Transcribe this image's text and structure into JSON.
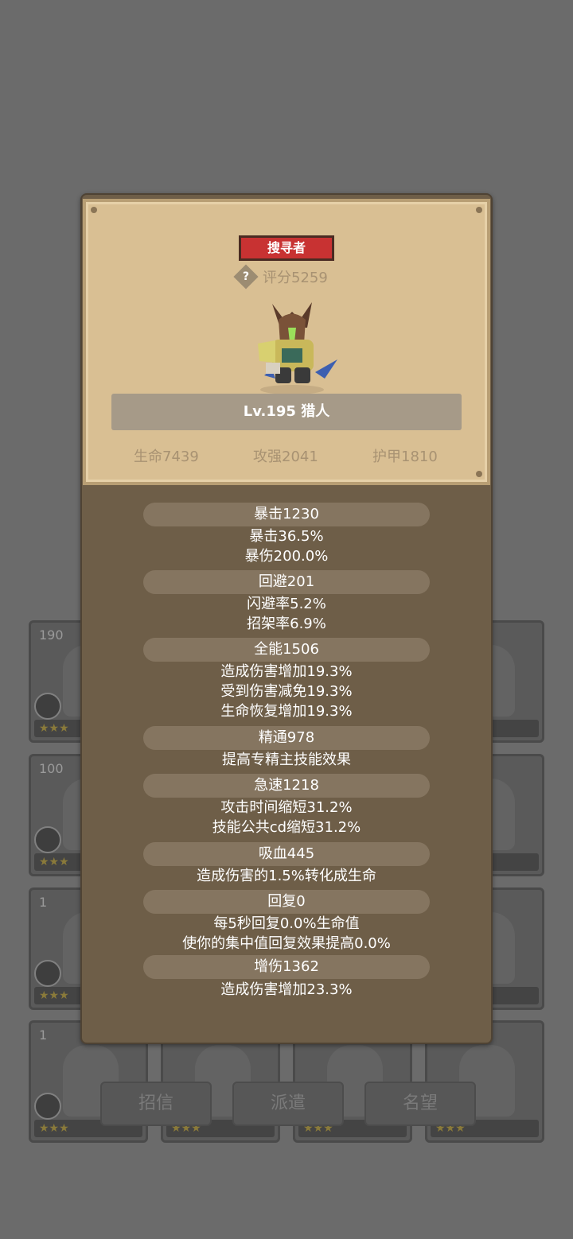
{
  "background": {
    "hero_cards": [
      {
        "level": "190",
        "stars": "★★★"
      },
      {
        "level": "",
        "stars": "★★★"
      },
      {
        "level": "100",
        "stars": "★★★"
      },
      {
        "level": "",
        "stars": "★★★"
      },
      {
        "level": "1",
        "stars": "★★★"
      },
      {
        "level": "",
        "stars": "★★★"
      },
      {
        "level": "1",
        "stars": "★★★"
      },
      {
        "level": "",
        "stars": "★★★"
      },
      {
        "level": "",
        "stars": "★★★"
      },
      {
        "level": "",
        "stars": "★★★"
      }
    ],
    "bottom_buttons": [
      "招信",
      "派遣",
      "名望"
    ]
  },
  "hero": {
    "class_badge": "搜寻者",
    "score": "评分5259",
    "name": "Lv.195 猎人",
    "hp": "生命7439",
    "attack": "攻强2041",
    "armor": "护甲1810"
  },
  "attributes": [
    {
      "header": "暴击1230",
      "details": [
        "暴击36.5%",
        "暴伤200.0%"
      ]
    },
    {
      "header": "回避201",
      "details": [
        "闪避率5.2%",
        "招架率6.9%"
      ]
    },
    {
      "header": "全能1506",
      "details": [
        "造成伤害增加19.3%",
        "受到伤害减免19.3%",
        "生命恢复增加19.3%"
      ]
    },
    {
      "header": "精通978",
      "details": [
        "提高专精主技能效果"
      ]
    },
    {
      "header": "急速1218",
      "details": [
        "攻击时间缩短31.2%",
        "技能公共cd缩短31.2%"
      ]
    },
    {
      "header": "吸血445",
      "details": [
        "造成伤害的1.5%转化成生命"
      ]
    },
    {
      "header": "回复0",
      "details": [
        "每5秒回复0.0%生命值",
        "使你的集中值回复效果提高0.0%"
      ]
    },
    {
      "header": "增伤1362",
      "details": [
        "造成伤害增加23.3%"
      ]
    }
  ],
  "colors": {
    "overlay": "#6b6b6b",
    "panel": "#6e5e48",
    "paper": "#d9bf93",
    "badge_red": "#c83232",
    "attr_header": "#857560"
  }
}
